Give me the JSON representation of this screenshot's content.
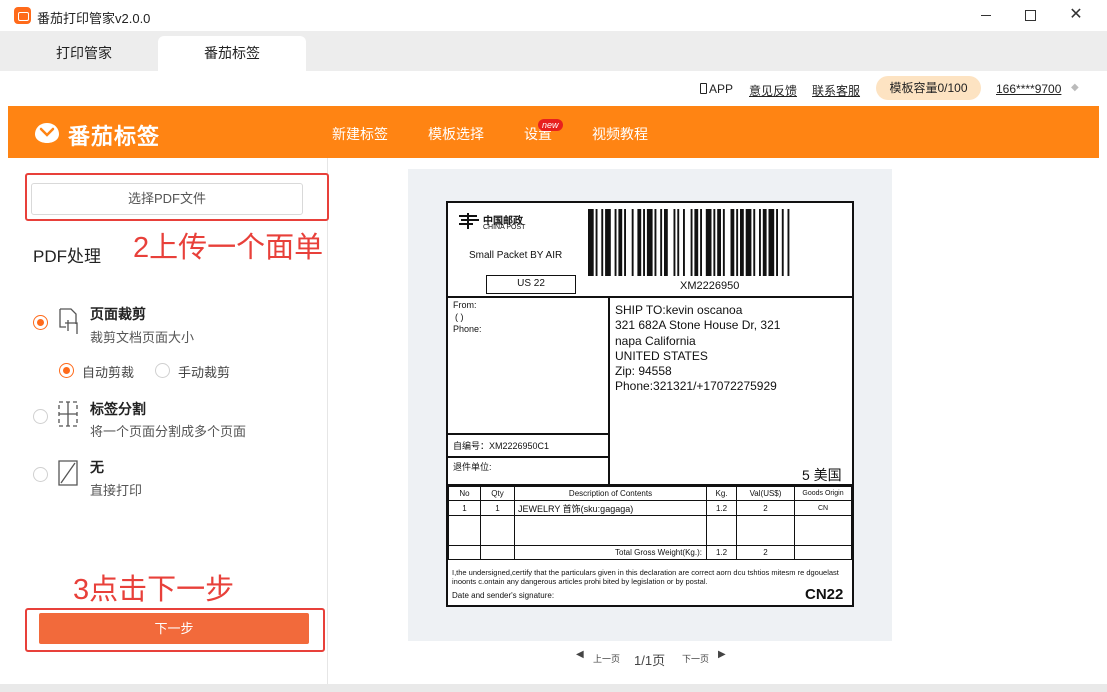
{
  "window": {
    "title": "番茄打印管家v2.0.0"
  },
  "tabs": [
    {
      "label": "打印管家"
    },
    {
      "label": "番茄标签"
    }
  ],
  "utility": {
    "app_label": "APP",
    "feedback": "意见反馈",
    "service": "联系客服",
    "capacity": "模板容量0/100",
    "account": "166****9700"
  },
  "navbar": {
    "brand": "番茄标签",
    "items": [
      "新建标签",
      "模板选择",
      "设置",
      "视频教程"
    ],
    "badge": "new",
    "accent": "#ff8413"
  },
  "left": {
    "pick_pdf": "选择PDF文件",
    "annotation_upload": "2上传一个面单",
    "pdf_heading": "PDF处理",
    "options": [
      {
        "title": "页面裁剪",
        "desc": "裁剪文档页面大小",
        "selected": true,
        "icon": "crop-icon"
      },
      {
        "title": "标签分割",
        "desc": "将一个页面分割成多个页面",
        "selected": false,
        "icon": "split-icon"
      },
      {
        "title": "无",
        "desc": "直接打印",
        "selected": false,
        "icon": "no-process-icon"
      }
    ],
    "crop_modes": [
      {
        "label": "自动剪裁",
        "selected": true
      },
      {
        "label": "手动裁剪",
        "selected": false
      }
    ],
    "annotation_next": "3点击下一步",
    "next_button": "下一步",
    "annotation_color": "#e8403a"
  },
  "label": {
    "logo_cn": "中国邮政",
    "logo_en": "CHINA POST",
    "service": "Small Packet BY AIR",
    "country_code": "US 22",
    "tracking": "XM2226950",
    "from_label": "From:",
    "from_paren": "(  )",
    "phone_label": "Phone:",
    "ship_to": [
      "SHIP TO:kevin oscanoa",
      "321 682A Stone House Dr, 321",
      "napa California",
      "UNITED STATES",
      "Zip: 94558",
      "Phone:321321/+17072275929"
    ],
    "self_number": "自编号：XM2226950C1",
    "return_unit": "退件单位:",
    "zone": "5 美国",
    "table_headers": [
      "No",
      "Qty",
      "Description of Contents",
      "Kg.",
      "Val(US$)",
      "Goods Origin"
    ],
    "item_row": [
      "1",
      "1",
      "JEWELRY  首饰(sku:gagaga)",
      "1.2",
      "2",
      "CN"
    ],
    "total_label": "Total Gross Weight(Kg.):",
    "total_kg": "1.2",
    "total_val": "2",
    "declaration": "I,the undersigned,certify that the particulars given in this declaration are correct aorn dcu tshtios mitesm re dgouelast inoonts c.ontain any dangerous articles prohi bited by legislation or by postal.",
    "signature": "Date and sender's signature:",
    "code": "CN22"
  },
  "pager": {
    "prev": "上一页",
    "page": "1/1页",
    "next": "下一页"
  }
}
